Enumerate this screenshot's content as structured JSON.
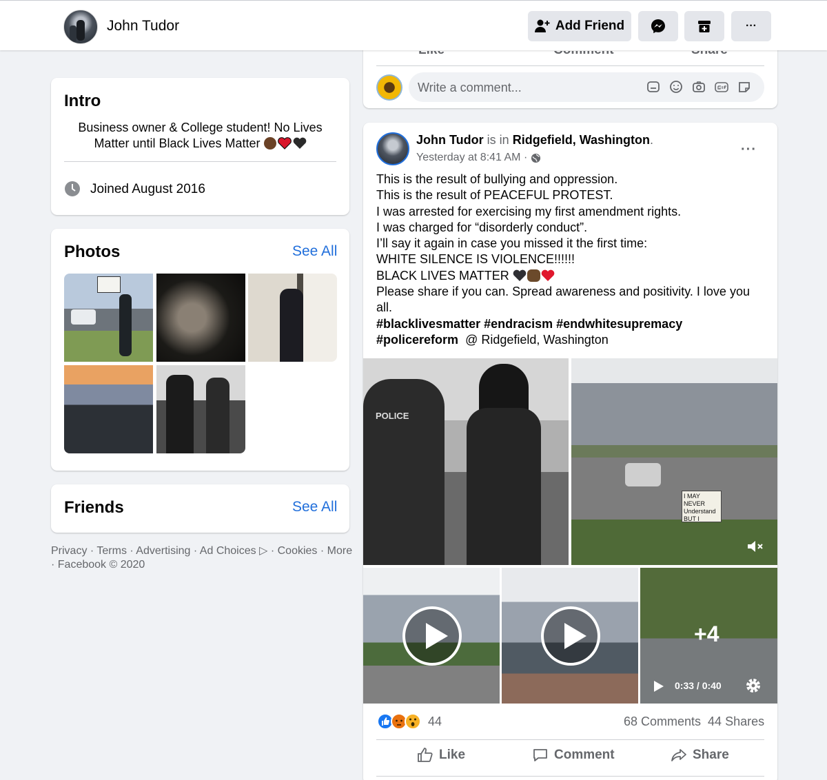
{
  "topbar": {
    "profile_name": "John Tudor",
    "add_friend_label": "Add Friend",
    "more_label": "···"
  },
  "intro": {
    "title": "Intro",
    "bio": "Business owner & College student! No Lives Matter until Black Lives Matter",
    "joined": "Joined August 2016"
  },
  "photos": {
    "title": "Photos",
    "see_all": "See All"
  },
  "friends": {
    "title": "Friends",
    "see_all": "See All"
  },
  "footer": {
    "links": [
      "Privacy",
      "Terms",
      "Advertising",
      "Ad Choices",
      "Cookies",
      "More"
    ],
    "copyright": "Facebook © 2020"
  },
  "prev_post": {
    "actions": [
      "Like",
      "Comment",
      "Share"
    ],
    "comment_placeholder": "Write a comment..."
  },
  "post": {
    "author": "John Tudor",
    "is_in": "is in",
    "location": "Ridgefield, Washington",
    "time": "Yesterday at 8:41 AM · ",
    "lines": [
      "This is the result of bullying and oppression.",
      "This is the result of PEACEFUL PROTEST.",
      "I was arrested for exercising my first amendment rights.",
      "I was charged for “disorderly conduct”.",
      "I’ll say it again in case you missed it the first time:",
      "WHITE SILENCE IS VIOLENCE!!!!!!",
      "BLACK LIVES MATTER",
      "Please share if you can. Spread awareness and positivity. I love you all."
    ],
    "hashtags": "#blacklivesmatter #endracism #endwhitesupremacy #policereform",
    "at_location": "@ Ridgefield, Washington",
    "police_text": "POLICE",
    "sign_text": "I MAY NEVER Understand BUT I STAND",
    "more_count": "+4",
    "video_time": "0:33 / 0:40",
    "reaction_count": "44",
    "comments": "68 Comments",
    "shares": "44 Shares",
    "actions": {
      "like": "Like",
      "comment": "Comment",
      "share": "Share"
    }
  }
}
